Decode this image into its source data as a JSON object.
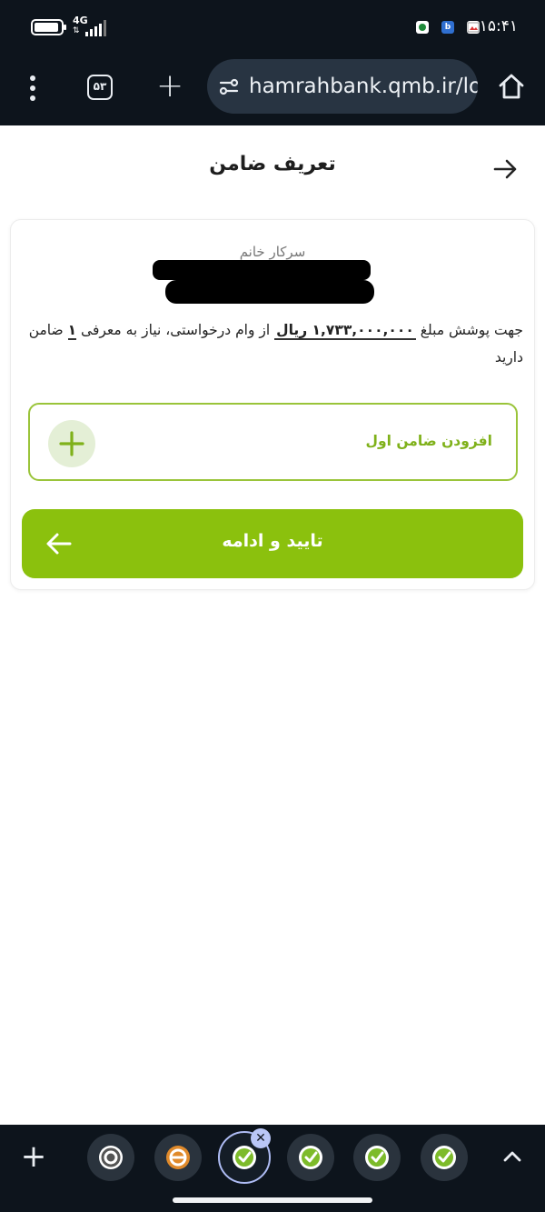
{
  "status_bar": {
    "network_type": "4G",
    "network_arrows": "⇅",
    "time": "۱۵:۴۱",
    "notification_icons": [
      "sim-app-icon",
      "bank-b-icon",
      "image-notification-icon"
    ]
  },
  "browser": {
    "url": "hamrahbank.qmb.ir/lo",
    "tab_count": "۵۳"
  },
  "page": {
    "title": "تعریف ضامن"
  },
  "card": {
    "greeting": "سرکار خانم",
    "info_prefix": "جهت پوشش مبلغ ",
    "amount": "۱,۷۳۳,۰۰۰,۰۰۰ ریال",
    "info_middle": " از وام درخواستی، نیاز به معرفی ",
    "guarantor_count": "۱",
    "info_suffix": " ضامن دارید",
    "add_guarantor_label": "افزودن ضامن اول",
    "confirm_label": "تایید و ادامه"
  },
  "bottom_tabs": {
    "favicons": [
      "chrome-icon",
      "e-app-icon",
      "green-check-icon",
      "green-check-icon",
      "green-check-icon",
      "green-check-icon"
    ]
  },
  "colors": {
    "accent_green": "#8bc10d",
    "outline_green": "#9ac43a",
    "browser_dark": "#0d141c",
    "url_pill": "#283442"
  }
}
